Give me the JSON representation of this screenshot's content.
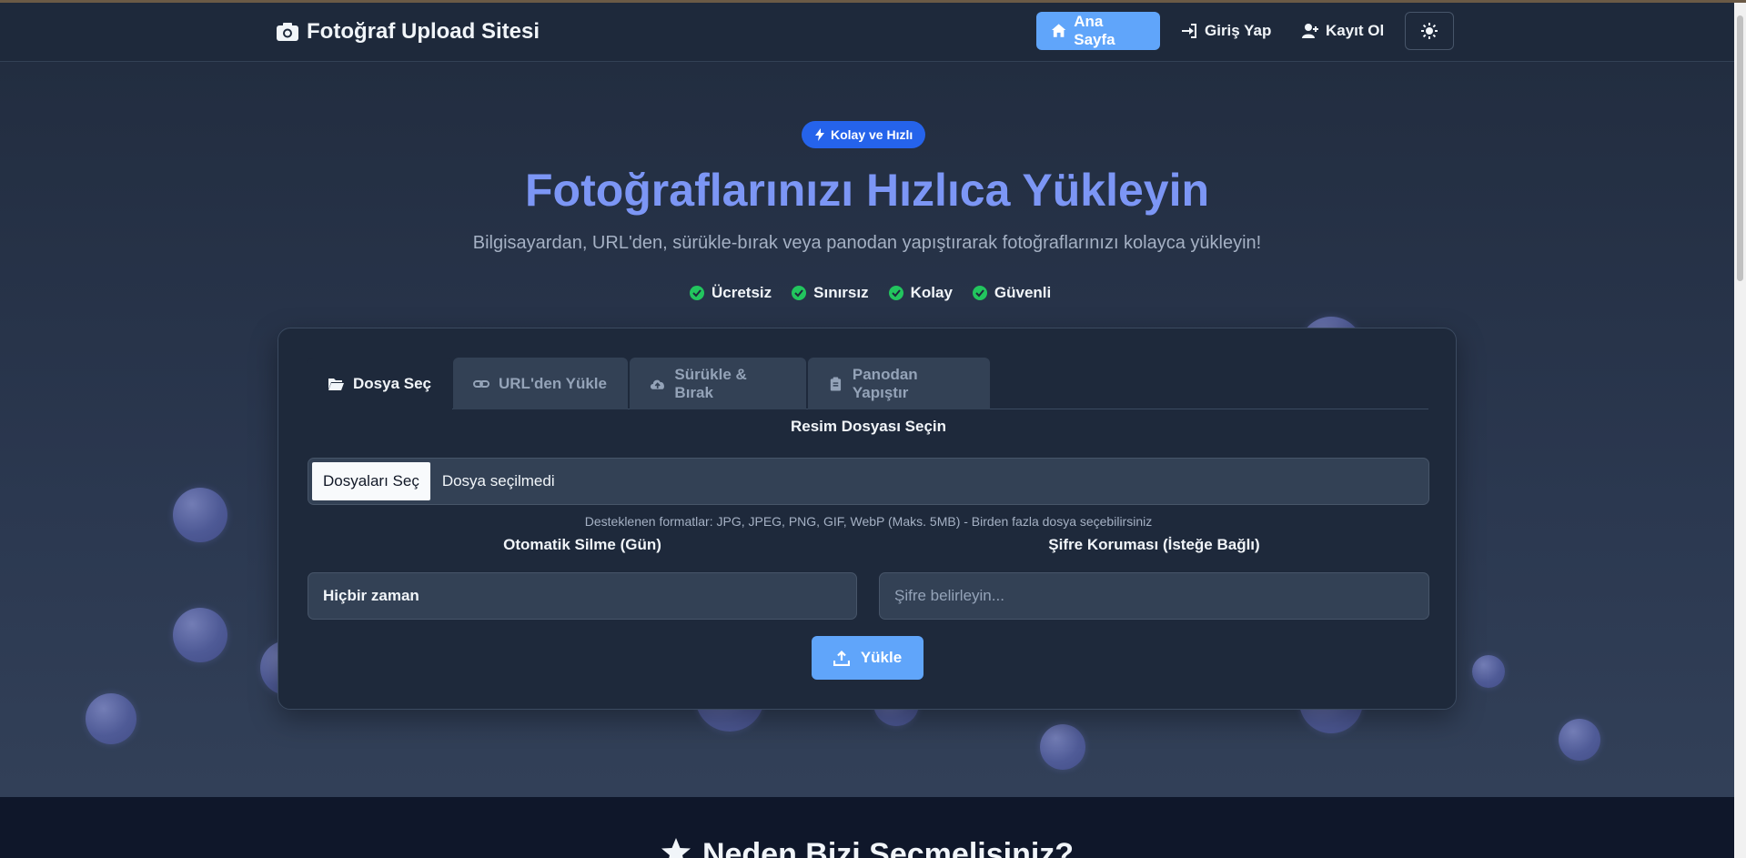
{
  "navbar": {
    "brand": "Fotoğraf Upload Sitesi",
    "home": "Ana Sayfa",
    "login": "Giriş Yap",
    "register": "Kayıt Ol"
  },
  "hero": {
    "badge": "Kolay ve Hızlı",
    "title": "Fotoğraflarınızı Hızlıca Yükleyin",
    "subtitle": "Bilgisayardan, URL'den, sürükle-bırak veya panodan yapıştırarak fotoğraflarınızı kolayca yükleyin!",
    "features": [
      "Ücretsiz",
      "Sınırsız",
      "Kolay",
      "Güvenli"
    ]
  },
  "upload_card": {
    "tabs": [
      "Dosya Seç",
      "URL'den Yükle",
      "Sürükle & Bırak",
      "Panodan Yapıştır"
    ],
    "file_label": "Resim Dosyası Seçin",
    "file_button": "Dosyaları Seç",
    "file_status": "Dosya seçilmedi",
    "hint": "Desteklenen formatlar: JPG, JPEG, PNG, GIF, WebP (Maks. 5MB) - Birden fazla dosya seçebilirsiniz",
    "delete_label": "Otomatik Silme (Gün)",
    "delete_value": "Hiçbir zaman",
    "password_label": "Şifre Koruması (İsteğe Bağlı)",
    "password_placeholder": "Şifre belirleyin...",
    "upload_button": "Yükle"
  },
  "next_section": {
    "title": "Neden Bizi Seçmelisiniz?"
  },
  "colors": {
    "accent": "#60a5fa",
    "badge": "#2563eb",
    "title": "#7c96f5",
    "check": "#22c55e"
  }
}
